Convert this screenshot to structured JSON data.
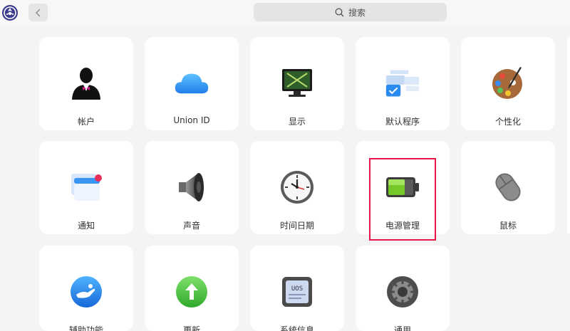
{
  "header": {
    "search_label": "搜索"
  },
  "modules": [
    {
      "label": "帐户",
      "icon": "account-icon"
    },
    {
      "label": "Union ID",
      "icon": "cloud-icon"
    },
    {
      "label": "显示",
      "icon": "monitor-icon"
    },
    {
      "label": "默认程序",
      "icon": "default-apps-icon"
    },
    {
      "label": "个性化",
      "icon": "palette-icon"
    },
    {
      "label": "通知",
      "icon": "notification-icon"
    },
    {
      "label": "声音",
      "icon": "speaker-icon"
    },
    {
      "label": "时间日期",
      "icon": "clock-icon"
    },
    {
      "label": "电源管理",
      "icon": "battery-icon"
    },
    {
      "label": "鼠标",
      "icon": "mouse-icon"
    },
    {
      "label": "辅助功能",
      "icon": "accessibility-icon"
    },
    {
      "label": "更新",
      "icon": "update-icon"
    },
    {
      "label": "系统信息",
      "icon": "system-info-icon"
    },
    {
      "label": "通用",
      "icon": "gear-icon"
    }
  ],
  "system_info_badge": "UOS",
  "colors": {
    "highlight": "#e8174a",
    "card": "#ffffff",
    "background": "#f4f4f4"
  }
}
